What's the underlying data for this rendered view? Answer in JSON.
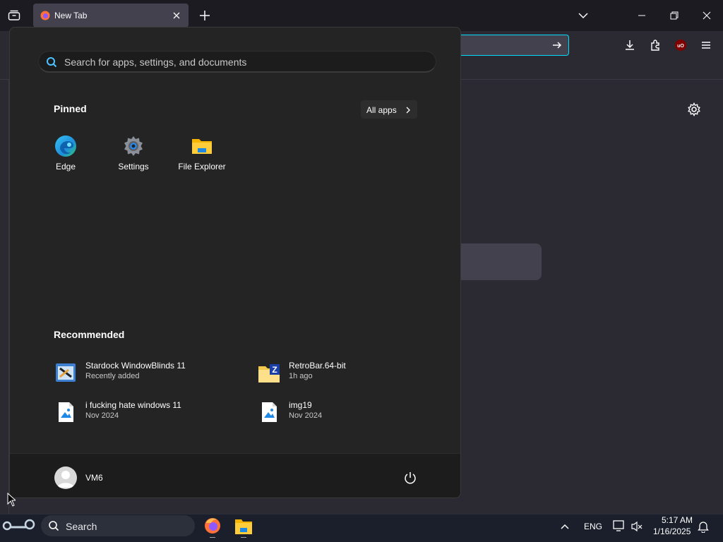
{
  "browser": {
    "tab_title": "New Tab"
  },
  "start_menu": {
    "search_placeholder": "Search for apps, settings, and documents",
    "pinned_title": "Pinned",
    "all_apps_label": "All apps",
    "pinned": [
      {
        "label": "Edge",
        "icon": "edge-icon"
      },
      {
        "label": "Settings",
        "icon": "settings-icon"
      },
      {
        "label": "File Explorer",
        "icon": "file-explorer-icon"
      }
    ],
    "recommended_title": "Recommended",
    "recommended": [
      {
        "name": "Stardock WindowBlinds 11",
        "sub": "Recently added",
        "icon": "windowblinds-icon"
      },
      {
        "name": "RetroBar.64-bit",
        "sub": "1h ago",
        "icon": "zip-folder-icon"
      },
      {
        "name": "i fucking hate windows 11",
        "sub": "Nov 2024",
        "icon": "image-file-icon"
      },
      {
        "name": "img19",
        "sub": "Nov 2024",
        "icon": "image-file-icon"
      }
    ],
    "user_name": "VM6"
  },
  "taskbar": {
    "search_label": "Search",
    "language": "ENG",
    "time": "5:17 AM",
    "date": "1/16/2025"
  },
  "colors": {
    "accent": "#00ddff",
    "start_bg": "#242424",
    "taskbar_bg": "#1a1f2b"
  }
}
